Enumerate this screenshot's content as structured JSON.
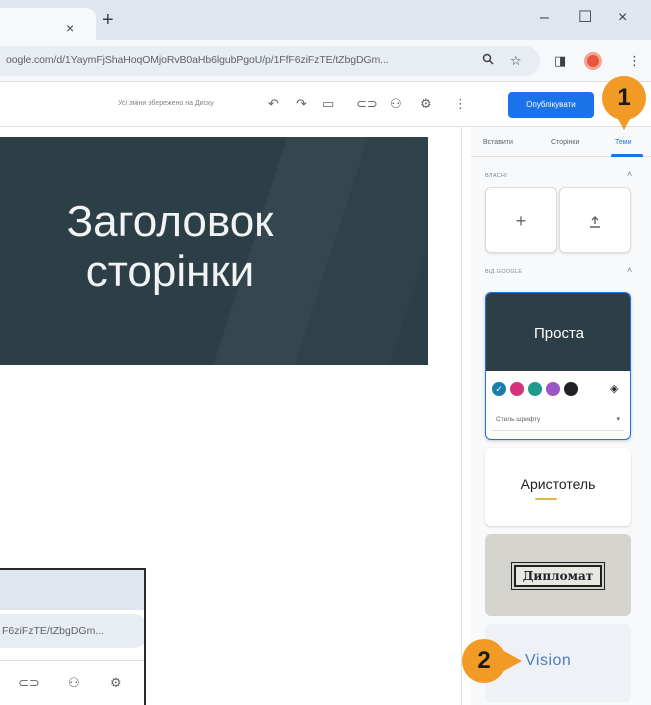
{
  "browser": {
    "tab_close": "×",
    "new_tab": "+",
    "minimize": "–",
    "maximize": "☐",
    "close": "×",
    "url": "oogle.com/d/1YaymFjShaHoqOMjoRvB0aHb6lgubPgoU/p/1FfF6ziFzTE/tZbgDGm...",
    "search_icon": "🔍",
    "star_icon": "☆",
    "sidebar_icon": "◨",
    "menu_icon": "⋮"
  },
  "header": {
    "save_status": "Усі зміни збережено на Диску",
    "publish_label": "Опублікувати",
    "icons": [
      "undo-icon",
      "redo-icon",
      "preview-icon",
      "link-icon",
      "share-icon",
      "settings-icon",
      "more-icon"
    ]
  },
  "canvas": {
    "title_line1": "Заголовок",
    "title_line2": "сторінки"
  },
  "panel": {
    "tabs": [
      "Вставити",
      "Сторінки",
      "Теми"
    ],
    "active_tab": "Теми",
    "section_custom": "ВЛАСНІ",
    "section_from_google": "ВІД GOOGLE",
    "themes": {
      "simple": "Проста",
      "simple_font_placeholder": "Стиль шрифту",
      "aristotle": "Аристотель",
      "diplomat": "Дипломат",
      "vision": "Vision"
    },
    "swatch_colors": [
      "#1a7ca8",
      "#d4327a",
      "#1f9a8c",
      "#9b58c4",
      "#202124"
    ]
  },
  "callouts": {
    "one": "1",
    "two": "2"
  },
  "inset": {
    "url": "F6ziFzTE/tZbgDGm..."
  }
}
